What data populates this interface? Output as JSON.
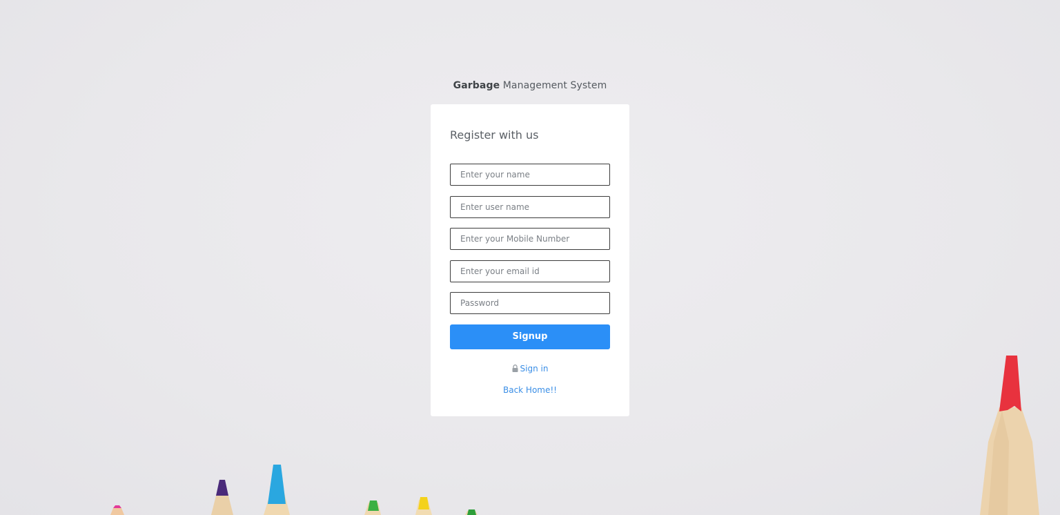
{
  "brand": {
    "bold": "Garbage",
    "rest": " Management System"
  },
  "form": {
    "title": "Register with us",
    "fields": [
      {
        "name": "name",
        "placeholder": "Enter your name"
      },
      {
        "name": "username",
        "placeholder": "Enter user name"
      },
      {
        "name": "mobile",
        "placeholder": "Enter your Mobile Number"
      },
      {
        "name": "email",
        "placeholder": "Enter your email id"
      },
      {
        "name": "password",
        "placeholder": "Password"
      }
    ],
    "submit_label": "Signup"
  },
  "links": {
    "signin_label": "Sign in",
    "signin_icon": "lock-icon",
    "back_home_label": "Back Home!!"
  },
  "colors": {
    "accent": "#2b8ff7",
    "link": "#3a8ee6",
    "background": "#eae9ec"
  }
}
